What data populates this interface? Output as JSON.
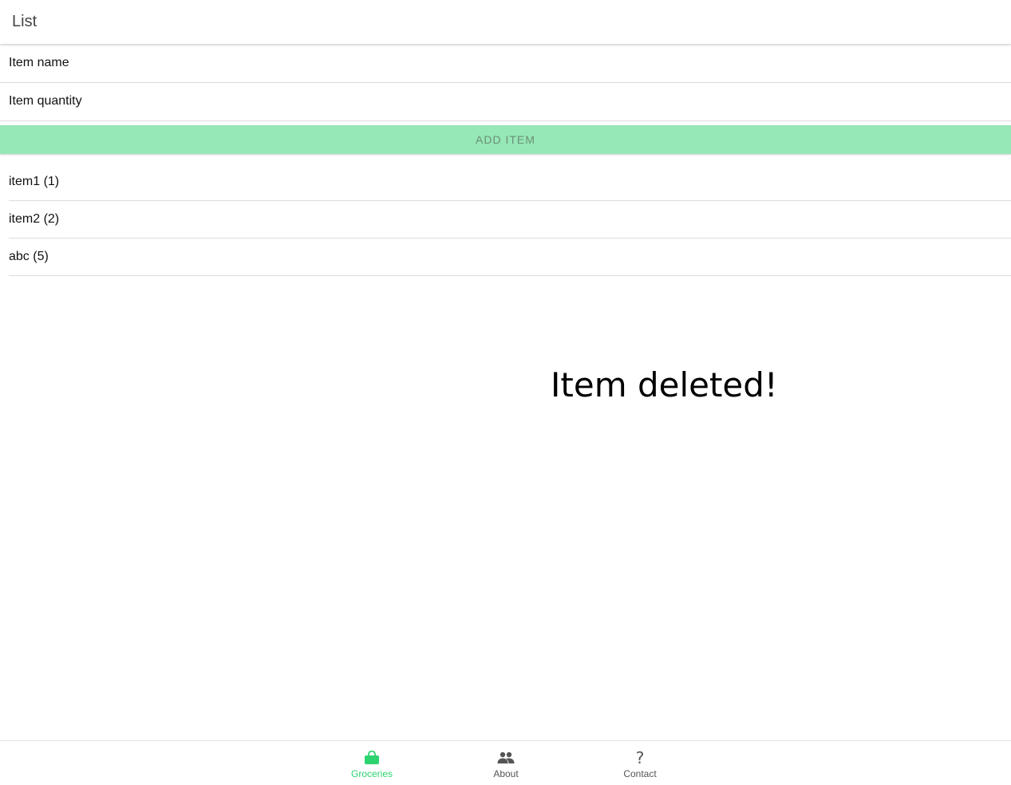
{
  "header": {
    "title": "List"
  },
  "form": {
    "name_placeholder": "Item name",
    "quantity_placeholder": "Item quantity",
    "add_label": "ADD ITEM"
  },
  "items": [
    {
      "label": "item1 (1)"
    },
    {
      "label": "item2 (2)"
    },
    {
      "label": "abc (5)"
    }
  ],
  "message": "Item deleted!",
  "tabs": [
    {
      "label": "Groceries",
      "icon": "basket-icon",
      "active": true
    },
    {
      "label": "About",
      "icon": "people-icon",
      "active": false
    },
    {
      "label": "Contact",
      "icon": "question-icon",
      "active": false,
      "glyph": "?"
    }
  ],
  "colors": {
    "accent": "#2dd36f",
    "button_bg": "#96e8b6",
    "button_text": "#6b8f77"
  }
}
